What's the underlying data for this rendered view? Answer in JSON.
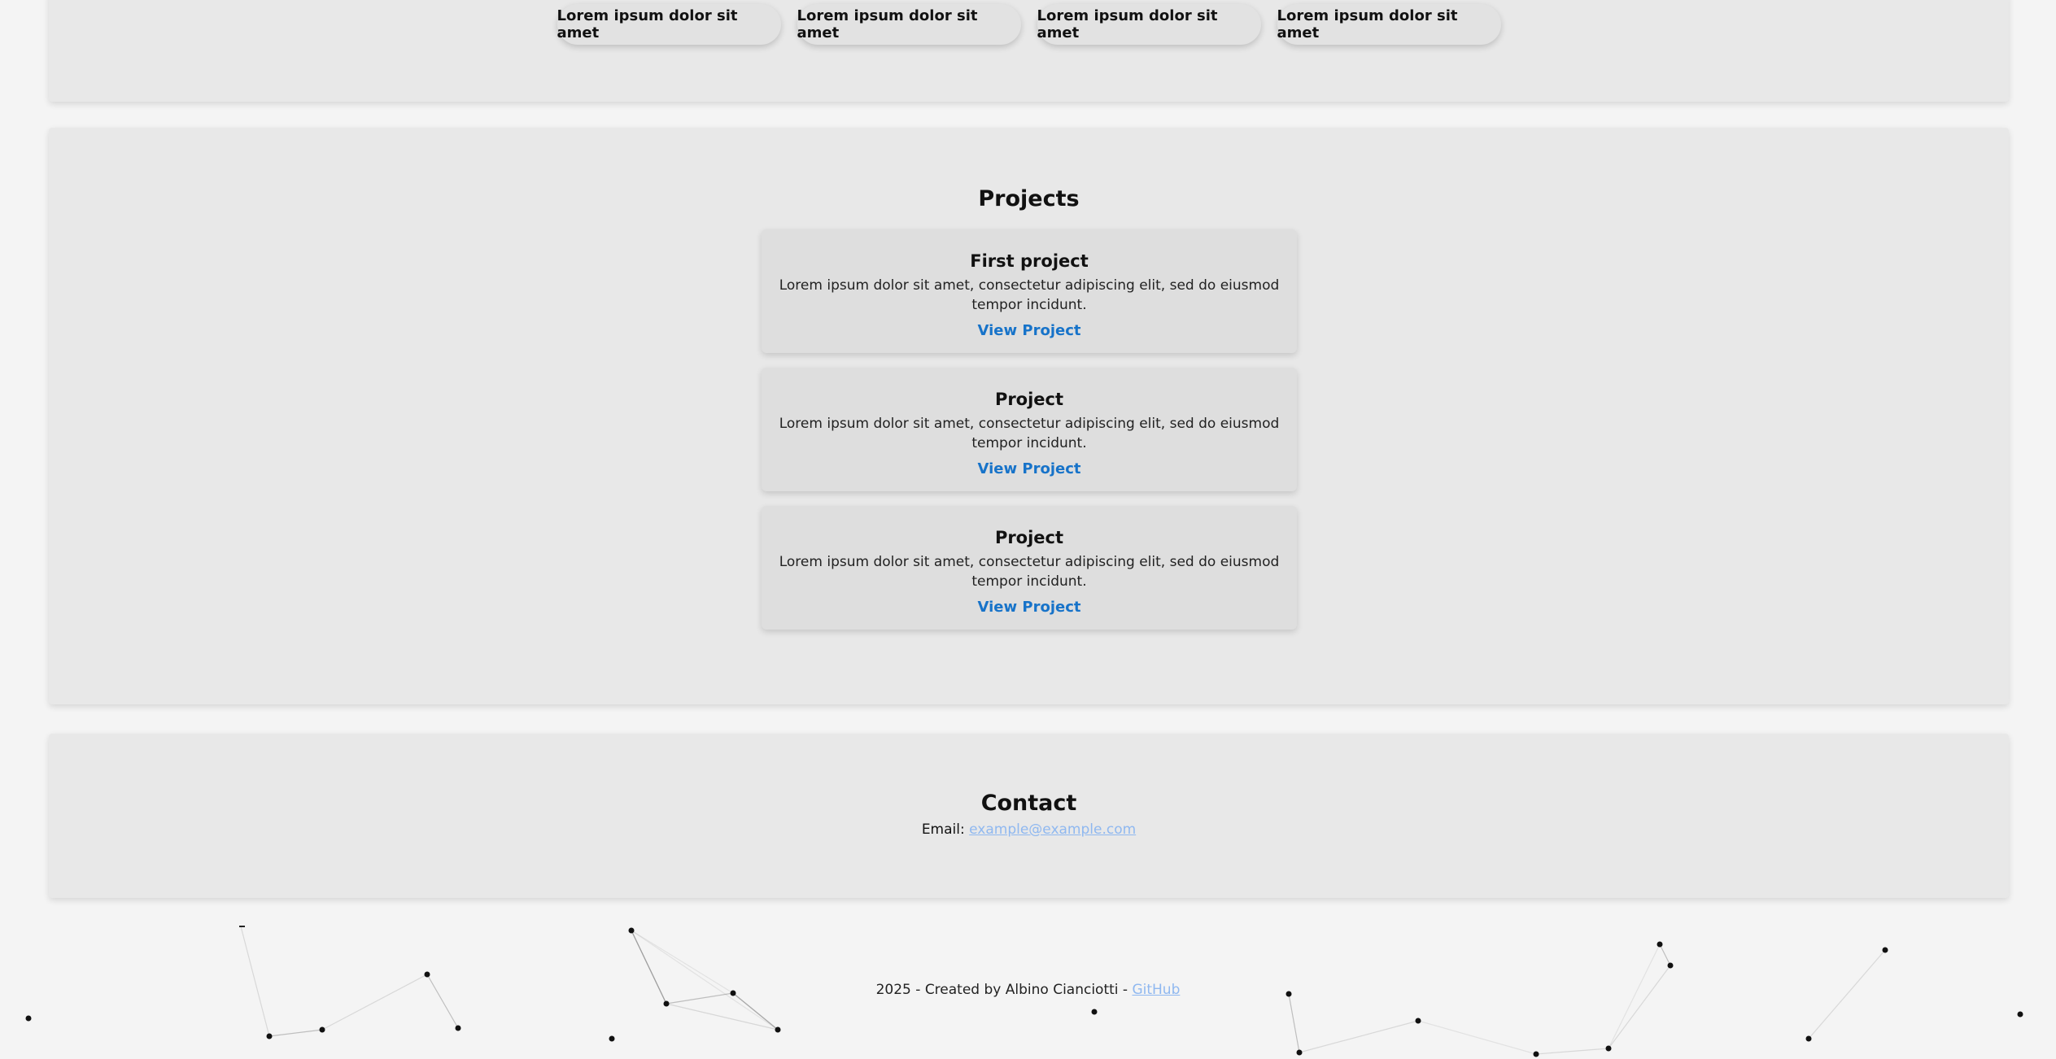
{
  "skills": [
    "Lorem ipsum dolor sit amet",
    "Lorem ipsum dolor sit amet",
    "Lorem ipsum dolor sit amet",
    "Lorem ipsum dolor sit amet"
  ],
  "projects": {
    "title": "Projects",
    "items": [
      {
        "name": "First project",
        "description": "Lorem ipsum dolor sit amet, consectetur adipiscing elit, sed do eiusmod tempor incidunt.",
        "link_label": "View Project"
      },
      {
        "name": "Project",
        "description": "Lorem ipsum dolor sit amet, consectetur adipiscing elit, sed do eiusmod tempor incidunt.",
        "link_label": "View Project"
      },
      {
        "name": "Project",
        "description": "Lorem ipsum dolor sit amet, consectetur adipiscing elit, sed do eiusmod tempor incidunt.",
        "link_label": "View Project"
      }
    ]
  },
  "contact": {
    "title": "Contact",
    "email_label": "Email:",
    "email": "example@example.com"
  },
  "footer": {
    "text": "2025 - Created by Albino Cianciotti -",
    "github_label": "GitHub"
  },
  "colors": {
    "link": "#1773c9",
    "muted_link": "#8fb8f0",
    "section_bg": "#e8e8e8",
    "page_bg": "#f4f4f4"
  }
}
